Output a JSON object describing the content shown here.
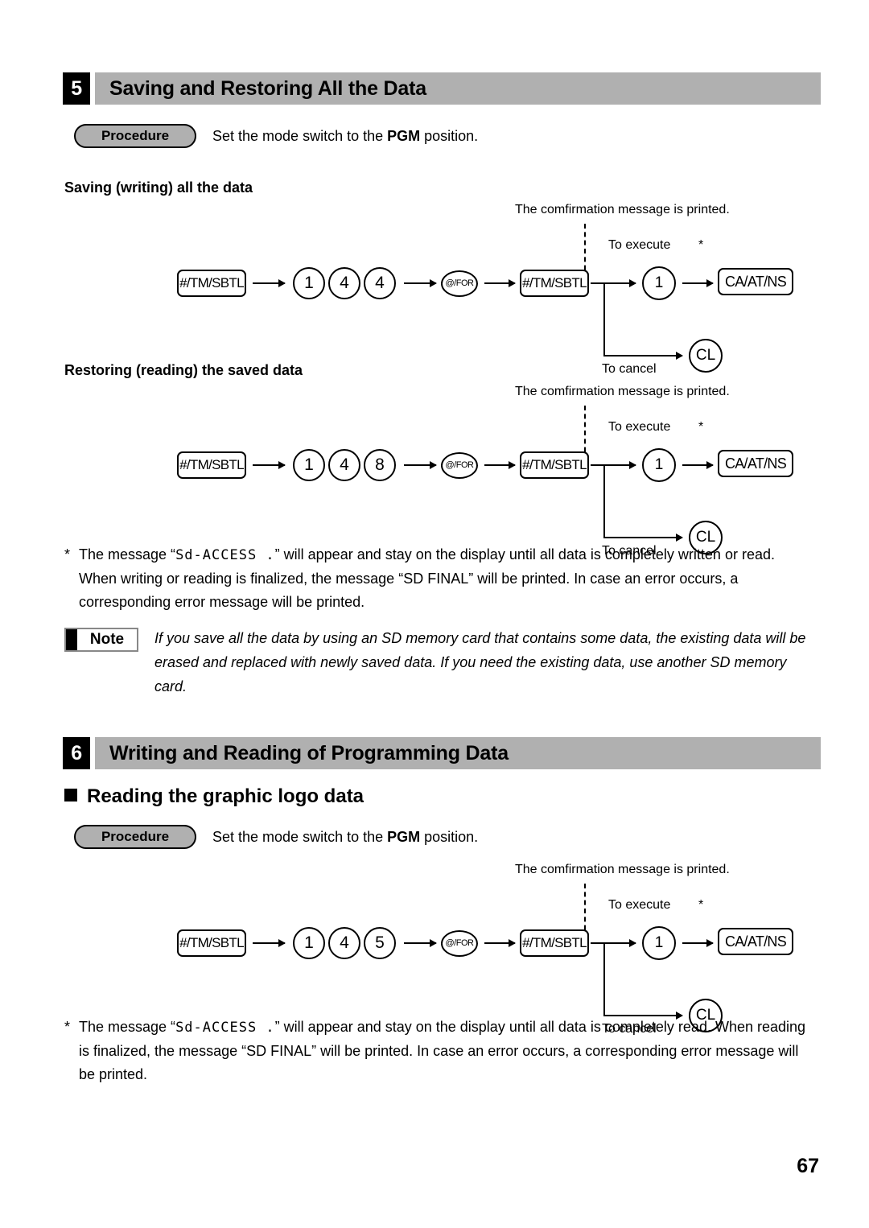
{
  "page": {
    "number": "67"
  },
  "sections": [
    {
      "number": "5",
      "title": "Saving and Restoring All the Data",
      "procedure": {
        "label": "Procedure",
        "text_before": "Set the mode switch to the ",
        "text_bold": "PGM",
        "text_after": " position."
      },
      "subheadings": [
        "Saving (writing) all the data",
        "Restoring (reading) the saved data"
      ]
    },
    {
      "number": "6",
      "title": "Writing and Reading of Programming Data",
      "bullet_heading": "Reading the graphic logo data",
      "procedure": {
        "label": "Procedure",
        "text_before": "Set the mode switch to the ",
        "text_bold": "PGM",
        "text_after": " position."
      }
    }
  ],
  "diagrams": [
    {
      "id": "saving-writing-all-data",
      "keys": {
        "start": "#/TM/SBTL",
        "digit1": "1",
        "digit2": "4",
        "digit3": "4",
        "for": "@/FOR",
        "confirm": "#/TM/SBTL",
        "execute_digit": "1",
        "execute_key": "CA/AT/NS",
        "cancel_key": "CL"
      },
      "labels": {
        "printed": "The comfirmation message is printed.",
        "to_execute": "To execute",
        "to_cancel": "To cancel",
        "star": "*"
      }
    },
    {
      "id": "restoring-reading-saved-data",
      "keys": {
        "start": "#/TM/SBTL",
        "digit1": "1",
        "digit2": "4",
        "digit3": "8",
        "for": "@/FOR",
        "confirm": "#/TM/SBTL",
        "execute_digit": "1",
        "execute_key": "CA/AT/NS",
        "cancel_key": "CL"
      },
      "labels": {
        "printed": "The comfirmation message is printed.",
        "to_execute": "To execute",
        "to_cancel": "To cancel",
        "star": "*"
      }
    },
    {
      "id": "reading-graphic-logo-data",
      "keys": {
        "start": "#/TM/SBTL",
        "digit1": "1",
        "digit2": "4",
        "digit3": "5",
        "for": "@/FOR",
        "confirm": "#/TM/SBTL",
        "execute_digit": "1",
        "execute_key": "CA/AT/NS",
        "cancel_key": "CL"
      },
      "labels": {
        "printed": "The comfirmation message is printed.",
        "to_execute": "To execute",
        "to_cancel": "To cancel",
        "star": "*"
      }
    }
  ],
  "footnotes": [
    {
      "id": "footnote-saving-restoring",
      "marker": "*",
      "part1": "The message “",
      "lcd": "Sd-ACCESS .",
      "part2": "” will appear and stay on the display until all data is completely written or read. When writing or reading is finalized, the message “SD FINAL” will be printed. In case an error occurs, a corresponding error message will be printed."
    },
    {
      "id": "footnote-graphic-logo",
      "marker": "*",
      "part1": "The message “",
      "lcd": "Sd-ACCESS .",
      "part2": "” will appear and stay on the display until all data is completely read. When reading is finalized, the message “SD FINAL” will be printed. In case an error occurs, a corresponding error message will be printed."
    }
  ],
  "note": {
    "label": "Note",
    "text": "If you save all the data by using an SD memory card that contains some data, the existing data will be erased and replaced with newly saved data. If you need the existing data, use another SD memory card."
  }
}
